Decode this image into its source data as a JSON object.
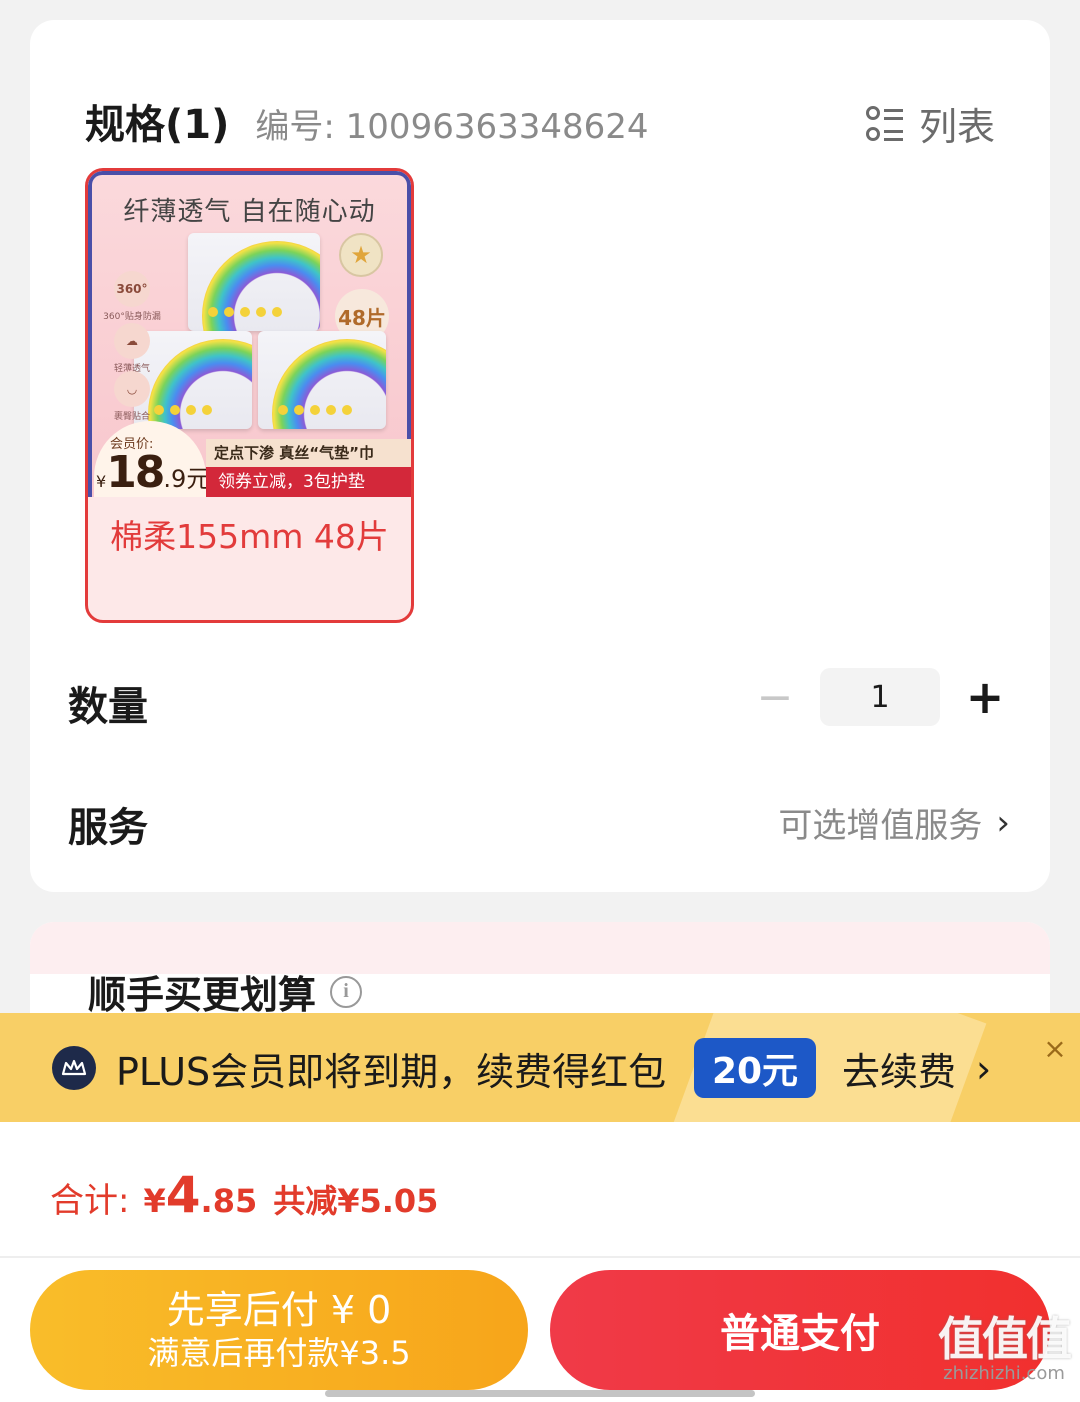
{
  "spec": {
    "title": "规格(1)",
    "code": "编号: 10096363348624",
    "list_icon": "list-view-icon",
    "list_label": "列表"
  },
  "sku": {
    "image": {
      "headline": "纤薄透气 自在随心动",
      "badge_count": "48片",
      "features": [
        "360°贴身防漏",
        "轻薄透气",
        "裹臀贴合"
      ],
      "feature_icons": [
        "360°",
        "☁",
        "◡"
      ],
      "member_price_label": "会员价:",
      "member_price_symbol": "¥",
      "member_price_int": "18",
      "member_price_dec": ".9元",
      "banner_line1": "定点下渗 真丝“气垫”巾",
      "banner_line2": "领券立减，3包护垫"
    },
    "label": "棉柔155mm 48片",
    "selected": true
  },
  "quantity": {
    "label": "数量",
    "value": "1",
    "minus": "−",
    "plus": "+"
  },
  "service": {
    "label": "服务",
    "value": "可选增值服务",
    "chevron": "›"
  },
  "addon": {
    "title": "顺手买更划算",
    "info_icon": "i"
  },
  "plus_banner": {
    "text": "PLUS会员即将到期，续费得红包",
    "amount": "20元",
    "action": "去续费",
    "chevron": "›",
    "close": "×",
    "accent": "#1d58c7"
  },
  "total": {
    "label": "合计:",
    "symbol": "¥",
    "int": "4",
    "dec": ".85",
    "saved": "共减¥5.05",
    "color": "#e23b2b"
  },
  "buttons": {
    "pay_later_line1": "先享后付 ¥ 0",
    "pay_later_line2": "满意后再付款¥3.5",
    "pay_normal": "普通支付"
  },
  "watermark": {
    "main": "值值值",
    "sub": "zhizhizhi.com"
  }
}
